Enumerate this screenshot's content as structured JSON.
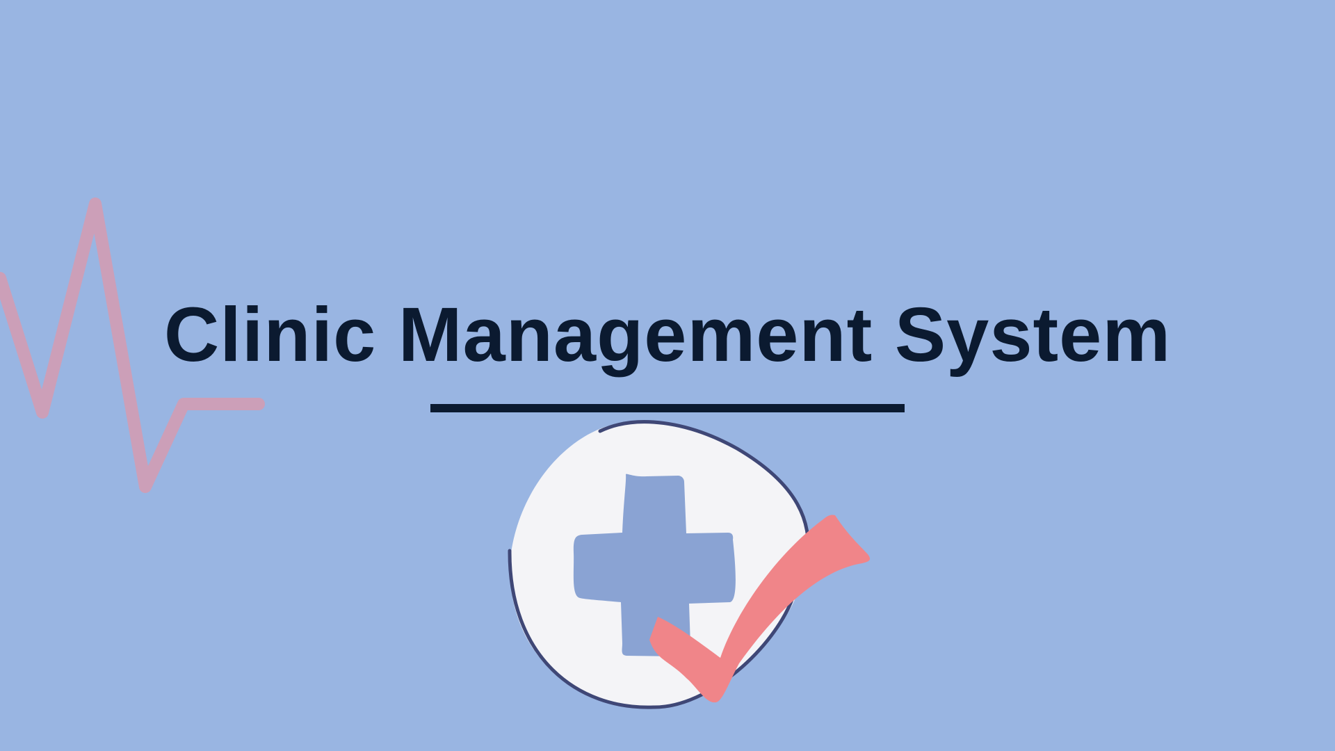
{
  "slide": {
    "title": "Clinic Management System"
  },
  "icons": {
    "heartbeat": "heartbeat-line-icon",
    "emblem": "medical-cross-icon",
    "check": "checkmark-icon"
  },
  "colors": {
    "background": "#99b5e2",
    "title_text": "#0b1a30",
    "heartbeat_line": "#cc9fb8",
    "emblem_circle": "#f4f4f7",
    "emblem_outline": "#3f4776",
    "medical_cross": "#8aa3d3",
    "checkmark": "#f08589"
  }
}
